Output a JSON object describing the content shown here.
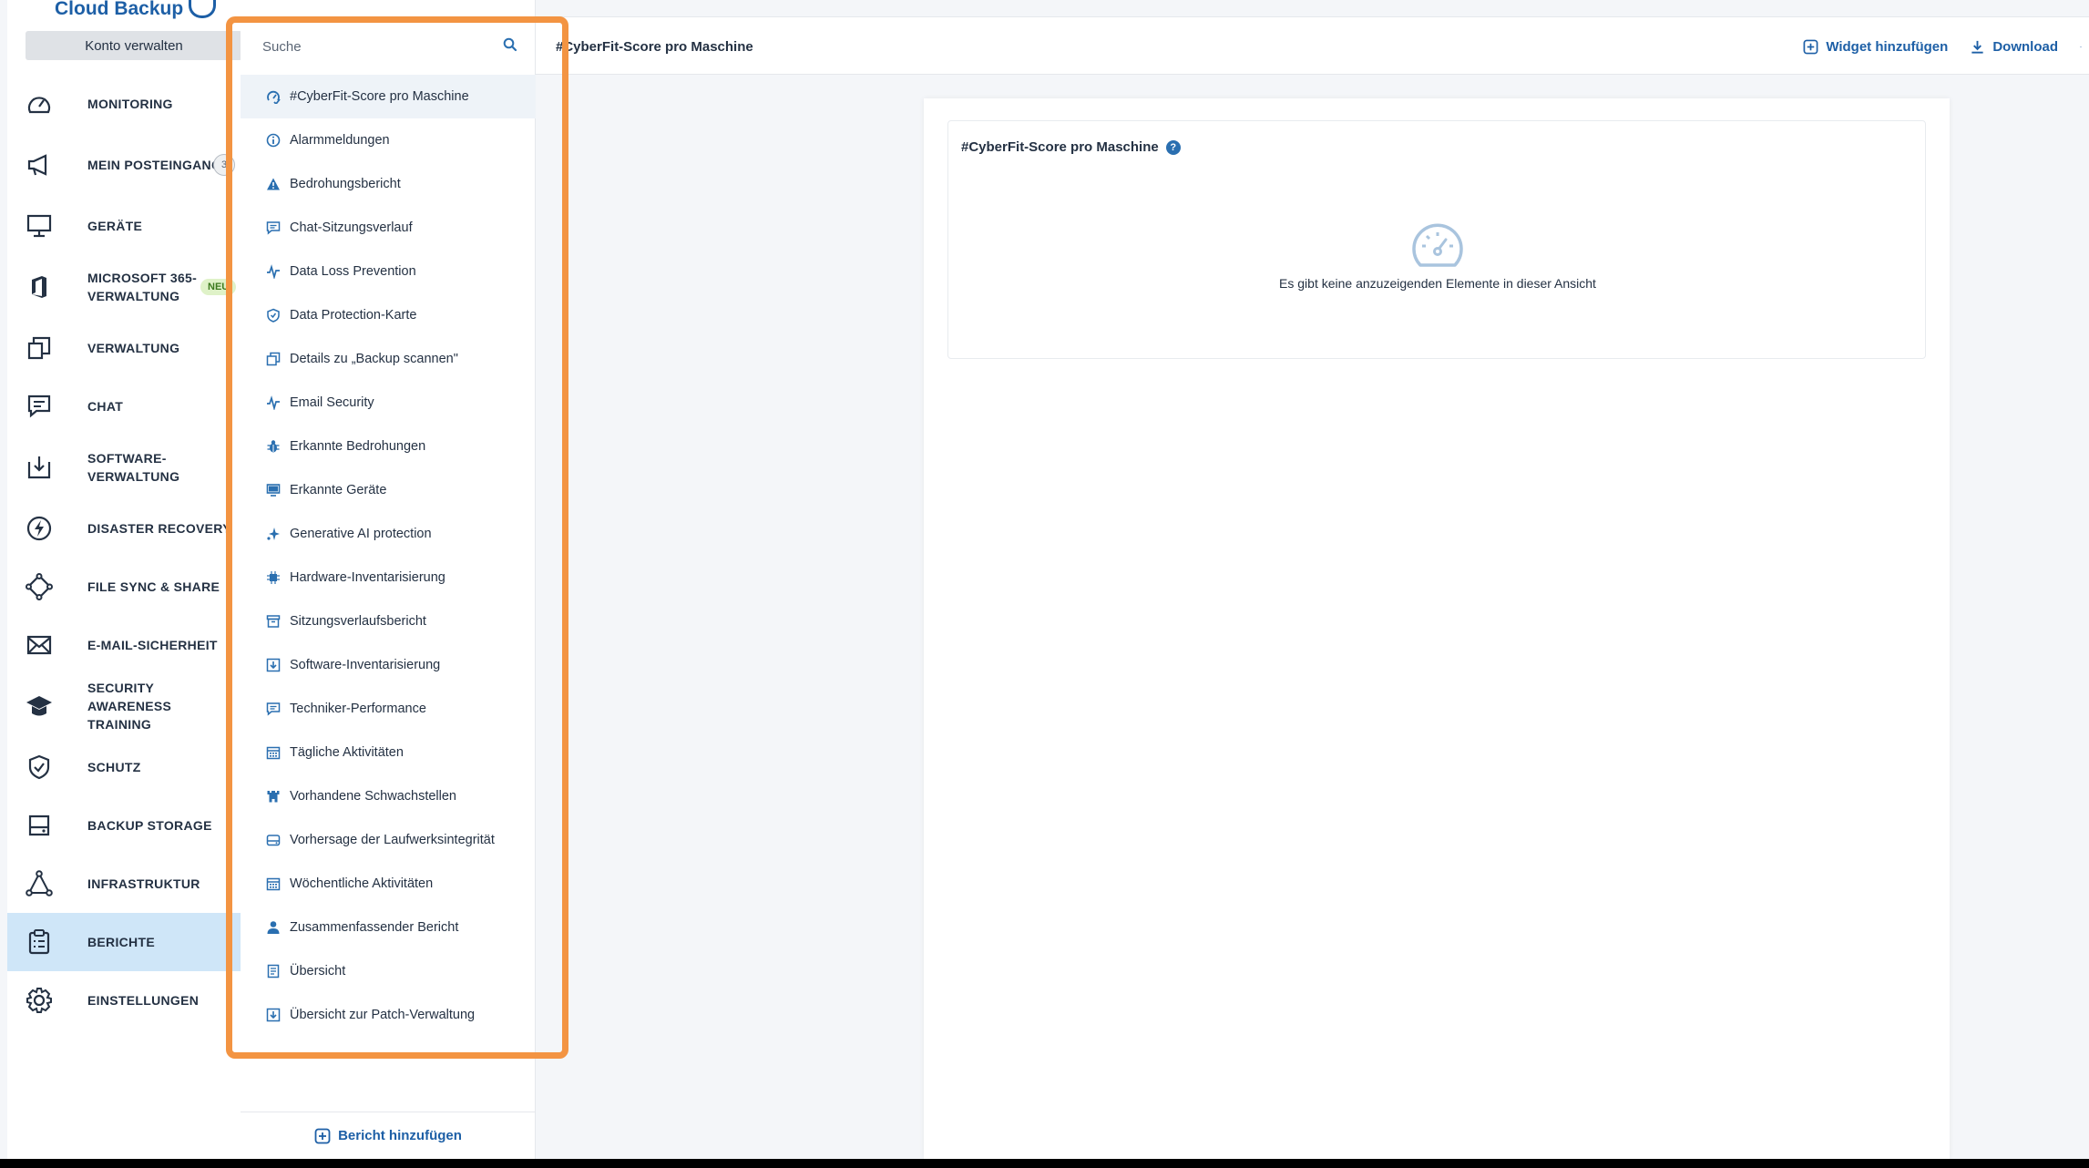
{
  "brand": {
    "name": "Cloud Backup",
    "accent": "#1d5fa6",
    "highlight": "#f39442"
  },
  "nav": {
    "manage_label": "Konto verwalten",
    "items": [
      {
        "label": "MONITORING",
        "icon": "speedometer-icon",
        "lines": 1
      },
      {
        "label": "MEIN POSTEINGANG",
        "icon": "megaphone-icon",
        "badge": "3",
        "lines": 2
      },
      {
        "label": "GERÄTE",
        "icon": "monitor-icon",
        "lines": 1
      },
      {
        "label": "MICROSOFT 365-VERWALTUNG",
        "icon": "office-icon",
        "tag": "NEU",
        "lines": 2
      },
      {
        "label": "VERWALTUNG",
        "icon": "copy-icon",
        "lines": 1
      },
      {
        "label": "CHAT",
        "icon": "chat-icon",
        "lines": 1
      },
      {
        "label": "SOFTWARE-VERWALTUNG",
        "icon": "software-icon",
        "lines": 2
      },
      {
        "label": "DISASTER RECOVERY",
        "icon": "lightning-icon",
        "lines": 1
      },
      {
        "label": "FILE SYNC & SHARE",
        "icon": "share-icon",
        "lines": 1
      },
      {
        "label": "E-MAIL-SICHERHEIT",
        "icon": "envelope-icon",
        "lines": 1
      },
      {
        "label": "SECURITY AWARENESS TRAINING",
        "icon": "graduation-cap-icon",
        "lines": 2
      },
      {
        "label": "SCHUTZ",
        "icon": "shield-check-icon",
        "lines": 1
      },
      {
        "label": "BACKUP STORAGE",
        "icon": "storage-icon",
        "lines": 1
      },
      {
        "label": "INFRASTRUKTUR",
        "icon": "network-icon",
        "lines": 1
      },
      {
        "label": "BERICHTE",
        "icon": "clipboard-icon",
        "lines": 1,
        "active": true
      },
      {
        "label": "EINSTELLUNGEN",
        "icon": "gear-icon",
        "lines": 1
      }
    ]
  },
  "reports": {
    "search_placeholder": "Suche",
    "items": [
      {
        "label": "#CyberFit-Score pro Maschine",
        "icon": "cyberfit-icon",
        "selected": true
      },
      {
        "label": "Alarmmeldungen",
        "icon": "info-icon"
      },
      {
        "label": "Bedrohungsbericht",
        "icon": "warning-icon"
      },
      {
        "label": "Chat-Sitzungsverlauf",
        "icon": "chat-icon"
      },
      {
        "label": "Data Loss Prevention",
        "icon": "pulse-icon"
      },
      {
        "label": "Data Protection-Karte",
        "icon": "shield-icon"
      },
      {
        "label": "Details zu „Backup scannen\"",
        "icon": "copy-icon"
      },
      {
        "label": "Email Security",
        "icon": "pulse-icon"
      },
      {
        "label": "Erkannte Bedrohungen",
        "icon": "bug-icon"
      },
      {
        "label": "Erkannte Geräte",
        "icon": "monitor-icon"
      },
      {
        "label": "Generative AI protection",
        "icon": "sparkle-icon"
      },
      {
        "label": "Hardware-Inventarisierung",
        "icon": "chip-icon"
      },
      {
        "label": "Sitzungsverlaufsbericht",
        "icon": "archive-icon"
      },
      {
        "label": "Software-Inventarisierung",
        "icon": "download-box-icon"
      },
      {
        "label": "Techniker-Performance",
        "icon": "chat-icon"
      },
      {
        "label": "Tägliche Aktivitäten",
        "icon": "calendar-icon"
      },
      {
        "label": "Vorhandene Schwachstellen",
        "icon": "castle-icon"
      },
      {
        "label": "Vorhersage der Laufwerksintegrität",
        "icon": "drive-icon"
      },
      {
        "label": "Wöchentliche Aktivitäten",
        "icon": "calendar-icon"
      },
      {
        "label": "Zusammenfassender Bericht",
        "icon": "user-icon"
      },
      {
        "label": "Übersicht",
        "icon": "document-icon"
      },
      {
        "label": "Übersicht zur Patch-Verwaltung",
        "icon": "download-box-icon"
      }
    ],
    "add_label": "Bericht hinzufügen"
  },
  "topbar": {
    "title": "#CyberFit-Score pro Maschine",
    "add_widget_label": "Widget hinzufügen",
    "download_label": "Download"
  },
  "widget": {
    "title": "#CyberFit-Score pro Maschine",
    "help": "?",
    "empty_text": "Es gibt keine anzuzeigenden Elemente in dieser Ansicht"
  }
}
